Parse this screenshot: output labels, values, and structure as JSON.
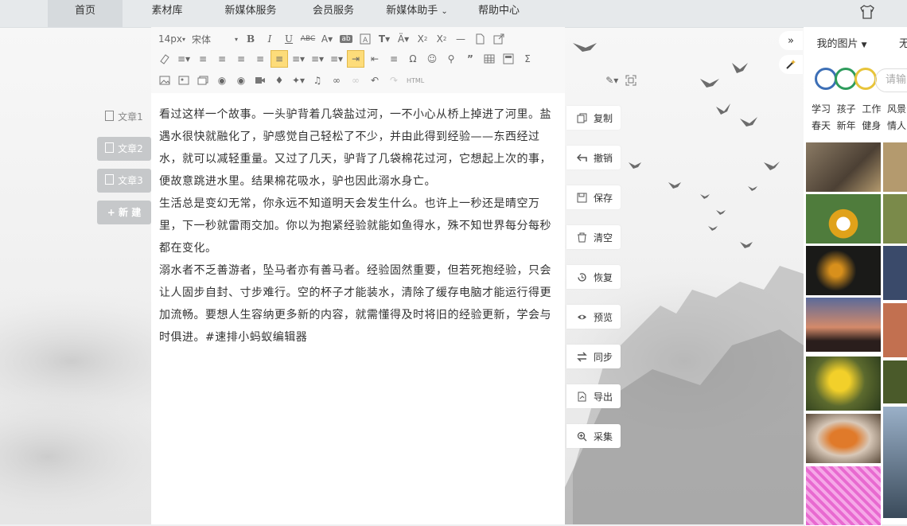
{
  "nav": {
    "items": [
      "首页",
      "素材库",
      "新媒体服务",
      "会员服务",
      "新媒体助手",
      "帮助中心"
    ]
  },
  "docs": {
    "items": [
      "文章1",
      "文章2",
      "文章3"
    ],
    "new_label": "新 建"
  },
  "toolbar": {
    "font_size": "14px",
    "font_family": "宋体",
    "html_label": "HTML"
  },
  "editor": {
    "paragraphs": [
      "看过这样一个故事。一头驴背着几袋盐过河，一不小心从桥上掉进了河里。盐遇水很快就融化了，驴感觉自己轻松了不少，并由此得到经验——东西经过水，就可以减轻重量。又过了几天，驴背了几袋棉花过河，它想起上次的事，便故意跳进水里。结果棉花吸水，驴也因此溺水身亡。",
      "生活总是变幻无常，你永远不知道明天会发生什么。也许上一秒还是晴空万里，下一秒就雷雨交加。你以为抱紧经验就能如鱼得水，殊不知世界每分每秒都在变化。",
      "溺水者不乏善游者，坠马者亦有善马者。经验固然重要，但若死抱经验，只会让人固步自封、寸步难行。空的杯子才能装水，清除了缓存电脑才能运行得更加流畅。要想人生容纳更多新的内容，就需懂得及时将旧的经验更新，学会与时俱进。#速排小蚂蚁编辑器"
    ]
  },
  "actions": {
    "copy": "复制",
    "undo": "撤销",
    "save": "保存",
    "clear": "清空",
    "restore": "恢复",
    "preview": "预览",
    "sync": "同步",
    "export": "导出",
    "collect": "采集"
  },
  "collapse_glyph": "»",
  "right_panel": {
    "tab_my_images": "我的图片",
    "tab_other": "无",
    "search_placeholder": "请输",
    "keywords_row1": [
      "学习",
      "孩子",
      "工作",
      "风景"
    ],
    "keywords_row2": [
      "春天",
      "新年",
      "健身",
      "情人"
    ]
  },
  "colors": {
    "accent_active": "#fddc7a",
    "cco_blue": "#3d6fb6",
    "cco_green": "#2e9c5c",
    "cco_yellow": "#e8c43a"
  }
}
